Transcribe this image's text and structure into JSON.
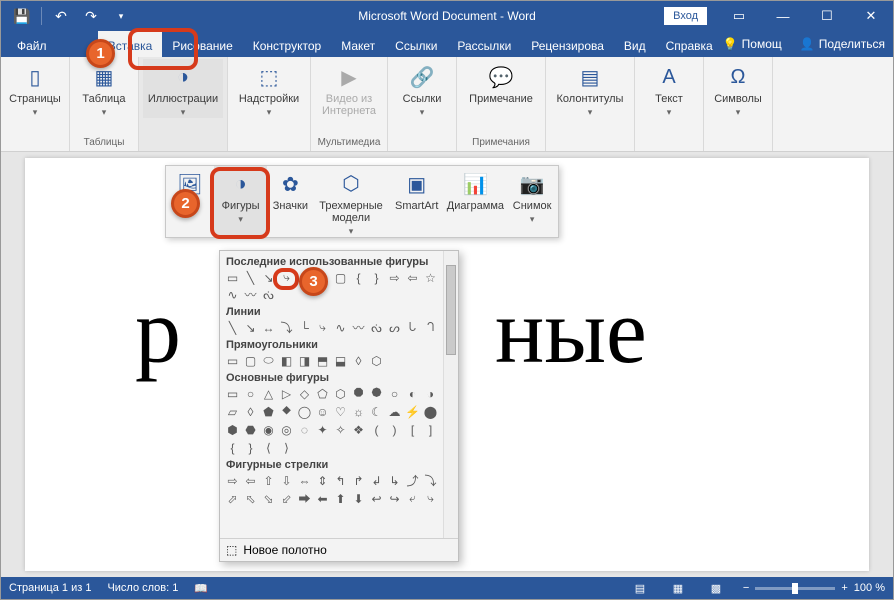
{
  "titlebar": {
    "title": "Microsoft Word Document  -  Word",
    "login": "Вход"
  },
  "tabs": {
    "file": "Файл",
    "insert": "Вставка",
    "draw": "Рисование",
    "design": "Конструктор",
    "layout": "Макет",
    "refs": "Ссылки",
    "mail": "Рассылки",
    "review": "Рецензирова",
    "view": "Вид",
    "help": "Справка",
    "tell": "Помощ",
    "share": "Поделиться"
  },
  "ribbon": {
    "pages": "Страницы",
    "table": "Таблица",
    "tables_group": "Таблицы",
    "illustrations": "Иллюстрации",
    "addins": "Надстройки",
    "video": "Видео из Интернета",
    "media_group": "Мультимедиа",
    "links": "Ссылки",
    "comment": "Примечание",
    "comments_group": "Примечания",
    "headerfooter": "Колонтитулы",
    "text": "Текст",
    "symbols": "Символы"
  },
  "flyout": {
    "pictures": "Рисунки",
    "shapes": "Фигуры",
    "icons": "Значки",
    "models3d": "Трехмерные модели",
    "smartart": "SmartArt",
    "chart": "Диаграмма",
    "screenshot": "Снимок"
  },
  "gallery": {
    "recent": "Последние использованные фигуры",
    "lines": "Линии",
    "rects": "Прямоугольники",
    "basic": "Основные фигуры",
    "arrows": "Фигурные стрелки",
    "canvas": "Новое полотно"
  },
  "document": {
    "fragment_left": "р",
    "fragment_right": "ные"
  },
  "status": {
    "page": "Страница 1 из 1",
    "words": "Число слов: 1",
    "zoom": "100 %",
    "minus": "−",
    "plus": "+"
  },
  "badges": {
    "b1": "1",
    "b2": "2",
    "b3": "3"
  }
}
